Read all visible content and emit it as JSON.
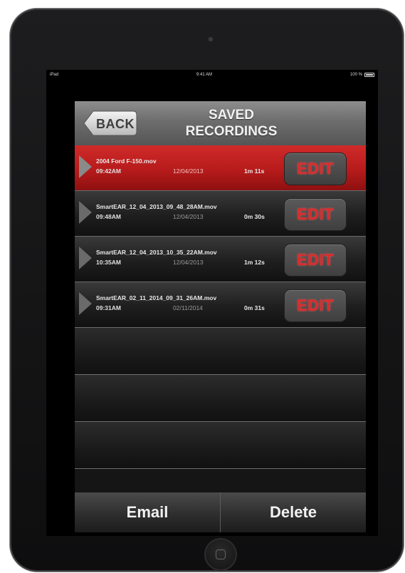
{
  "status_bar": {
    "carrier": "iPad",
    "time": "9:41 AM",
    "battery": "100 %"
  },
  "header": {
    "back_label": "BACK",
    "title_line1": "SAVED",
    "title_line2": "RECORDINGS"
  },
  "recordings": [
    {
      "filename": "2004 Ford F-150.mov",
      "time": "09:42AM",
      "date": "12/04/2013",
      "duration": "1m 11s",
      "edit_label": "EDIT",
      "selected": true
    },
    {
      "filename": "SmartEAR_12_04_2013_09_48_28AM.mov",
      "time": "09:48AM",
      "date": "12/04/2013",
      "duration": "0m 30s",
      "edit_label": "EDIT",
      "selected": false
    },
    {
      "filename": "SmartEAR_12_04_2013_10_35_22AM.mov",
      "time": "10:35AM",
      "date": "12/04/2013",
      "duration": "1m 12s",
      "edit_label": "EDIT",
      "selected": false
    },
    {
      "filename": "SmartEAR_02_11_2014_09_31_26AM.mov",
      "time": "09:31AM",
      "date": "02/11/2014",
      "duration": "0m 31s",
      "edit_label": "EDIT",
      "selected": false
    }
  ],
  "bottom_bar": {
    "email_label": "Email",
    "delete_label": "Delete"
  },
  "colors": {
    "selected_row": "#b71b1b",
    "edit_text": "#d92b2b",
    "header": "#6d6d6d"
  }
}
